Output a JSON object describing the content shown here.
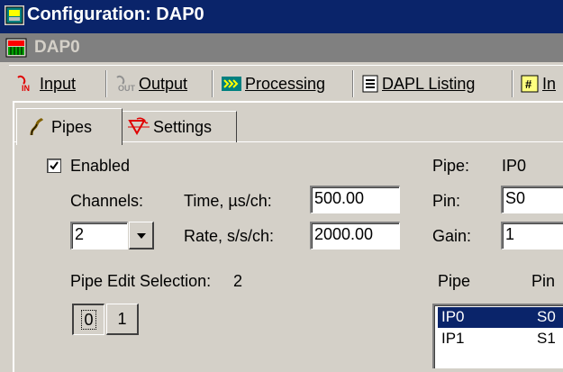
{
  "window": {
    "title": "Configuration: DAP0"
  },
  "subwindow": {
    "title": "DAP0"
  },
  "tabs": [
    {
      "label": "Input",
      "underline_char": "I"
    },
    {
      "label": "Output",
      "underline_char": "O"
    },
    {
      "label": "Processing",
      "underline_char": "P"
    },
    {
      "label": "DAPL Listing",
      "underline_char": "D"
    },
    {
      "label": "In",
      "underline_char": "I"
    }
  ],
  "subtabs": [
    {
      "label": "Pipes"
    },
    {
      "label": "Settings"
    }
  ],
  "enabled": {
    "label": "Enabled",
    "checked": true
  },
  "channels": {
    "label": "Channels:",
    "value": "2"
  },
  "time": {
    "label": "Time, µs/ch:",
    "value": "500.00"
  },
  "rate": {
    "label": "Rate, s/s/ch:",
    "value": "2000.00"
  },
  "pipe": {
    "label": "Pipe:",
    "value": "IP0"
  },
  "pin": {
    "label": "Pin:",
    "value": "S0"
  },
  "gain": {
    "label": "Gain:",
    "value": "1"
  },
  "pipe_edit": {
    "label": "Pipe Edit Selection:",
    "value": "2",
    "buttons": [
      "0",
      "1"
    ]
  },
  "pipe_list": {
    "headers": [
      "Pipe",
      "Pin"
    ],
    "rows": [
      {
        "pipe": "IP0",
        "pin": "S0",
        "selected": true
      },
      {
        "pipe": "IP1",
        "pin": "S1",
        "selected": false
      }
    ]
  },
  "colors": {
    "titlebar": "#0a246a",
    "window_bg": "#d4d0c8",
    "selection": "#0a246a"
  }
}
